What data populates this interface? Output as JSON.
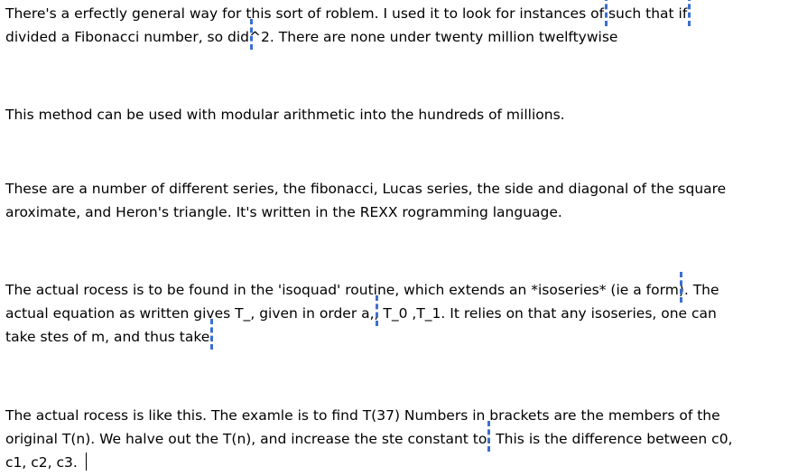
{
  "paragraphs": [
    {
      "lines": [
        [
          "There's a erfectly general way for this sort of roblem.  I used it to look for instances of",
          "",
          " such that if",
          ""
        ],
        [
          "divided a Fibonacci number, so did",
          "",
          "^2. There are none under twenty million twelftywise"
        ]
      ]
    },
    {
      "lines": [
        [
          "This method can be used with modular arithmetic into the hundreds of millions."
        ]
      ]
    },
    {
      "lines": [
        [
          "These are a number of different series, the fibonacci, Lucas series, the side and diagonal of the square"
        ],
        [
          "aroximate, and Heron's triangle.  It's written in the REXX rogramming language."
        ]
      ]
    },
    {
      "lines": [
        [
          "The actual rocess is to be found in the 'isoquad' routine, which extends an *isoseries* (ie a form",
          "",
          ").  The"
        ],
        [
          "actual equation as written gives T_, given in order a,",
          "",
          ", T_0 ,T_1.  It relies on that any isoseries, one can"
        ],
        [
          "take stes of m, and thus take",
          "",
          "."
        ]
      ]
    },
    {
      "lines": [
        [
          "The actual rocess is like this.  The examle is to find T(37)  Numbers in brackets are the members of the"
        ],
        [
          "original T(n).  We halve out the T(n), and increase the ste constant to",
          "",
          ".  This is the difference between c0,"
        ],
        [
          "c1, c2, c3. "
        ]
      ]
    }
  ]
}
